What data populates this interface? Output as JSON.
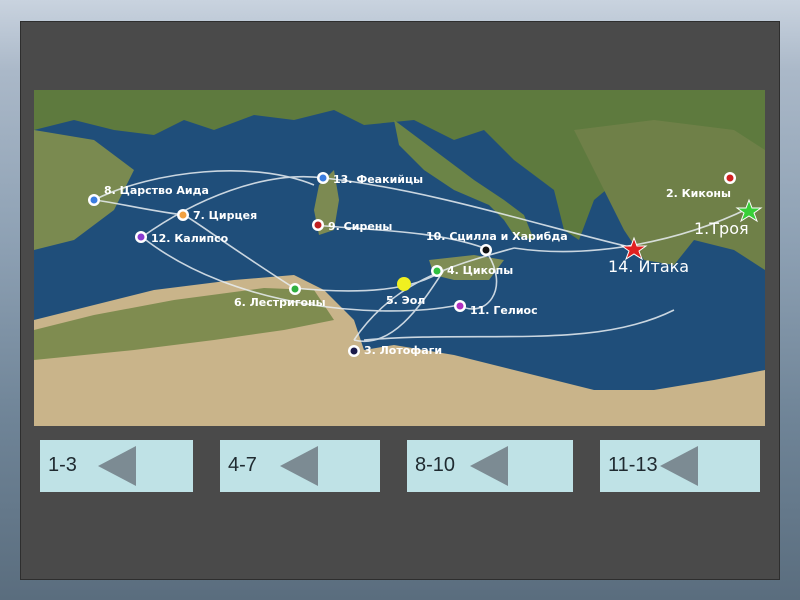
{
  "map": {
    "markers": [
      {
        "label": "8. Царство Аида",
        "color": "#3b7de0"
      },
      {
        "label": "7. Цирцея",
        "color": "#f0a040"
      },
      {
        "label": "12. Калипсо",
        "color": "#8a3ad0"
      },
      {
        "label": "13. Феакийцы",
        "color": "#3b7de0"
      },
      {
        "label": "9. Сирены",
        "color": "#c02020"
      },
      {
        "label": "10. Сцилла и Харибда",
        "color": "#111111"
      },
      {
        "label": "4. Цикопы",
        "color": "#30c040"
      },
      {
        "label": "5. Эол",
        "color": "#f0f020"
      },
      {
        "label": "11. Гелиос",
        "color": "#b030c0"
      },
      {
        "label": "6. Лестригоны",
        "color": "#30b040"
      },
      {
        "label": "3. Лотофаги",
        "color": "#1a1a4a"
      },
      {
        "label": "2. Киконы",
        "color": "#d02020"
      }
    ],
    "troy_label": "1.Троя",
    "ithaca_label": "14. Итака"
  },
  "nav": [
    {
      "label": "1-3"
    },
    {
      "label": "4-7"
    },
    {
      "label": "8-10"
    },
    {
      "label": "11-13"
    }
  ]
}
